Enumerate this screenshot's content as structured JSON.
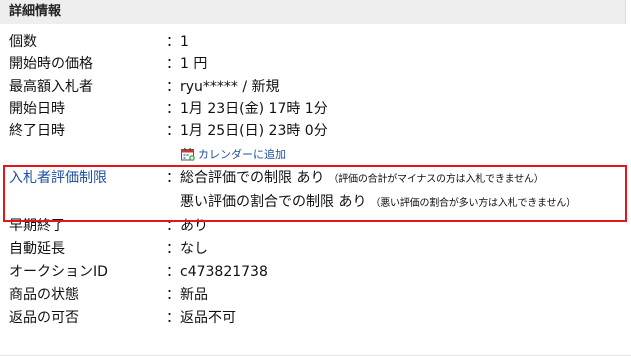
{
  "header": {
    "title": "詳細情報"
  },
  "rows": [
    {
      "label": "個数",
      "value": "1"
    },
    {
      "label": "開始時の価格",
      "value": "1 円"
    },
    {
      "label": "最高額入札者",
      "value": "ryu***** / 新規"
    },
    {
      "label": "開始日時",
      "value": "1月 23日(金) 17時 1分"
    },
    {
      "label": "終了日時",
      "value": "1月 25日(日) 23時 0分"
    }
  ],
  "calendar": {
    "label": "カレンダーに追加",
    "icon": "calendar-add-icon"
  },
  "restriction": {
    "label": "入札者評価制限",
    "line1": {
      "main": "総合評価での制限 あり",
      "note": "（評価の合計がマイナスの方は入札できません）"
    },
    "line2": {
      "main": "悪い評価の割合での制限 あり",
      "note": "（悪い評価の割合が多い方は入札できません）"
    }
  },
  "rows2": [
    {
      "label": "早期終了",
      "value": "あり"
    },
    {
      "label": "自動延長",
      "value": "なし"
    },
    {
      "label": "オークションID",
      "value": "c473821738"
    },
    {
      "label": "商品の状態",
      "value": "新品"
    },
    {
      "label": "返品の可否",
      "value": "返品不可"
    }
  ],
  "colon": "：",
  "colors": {
    "link": "#1f4fa0",
    "highlight_border": "#e2161b",
    "header_bg": "#eeeeee"
  }
}
